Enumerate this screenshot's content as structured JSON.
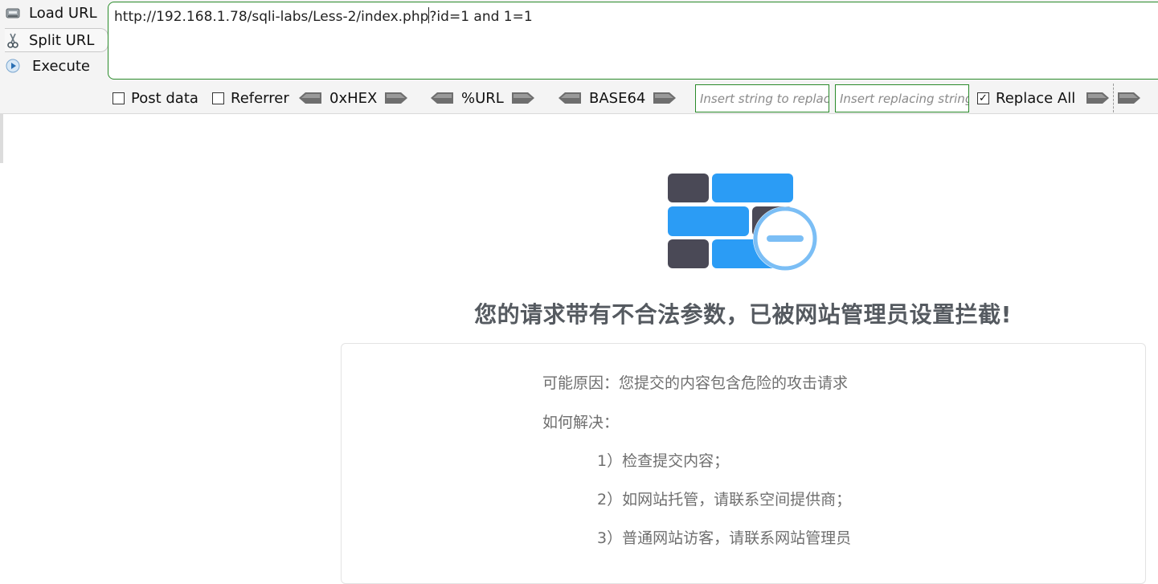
{
  "toolbar": {
    "load_url_label": "Load URL",
    "split_url_label": "Split URL",
    "execute_label": "Execute",
    "url_before_caret": "http://192.168.1.78/sqli-labs/Less-2/index.php",
    "url_after_caret": "?id=1 and 1=1",
    "post_data_label": "Post data",
    "referrer_label": "Referrer",
    "hex_label": "0xHEX",
    "url_enc_label": "%URL",
    "base64_label": "BASE64",
    "find_placeholder": "Insert string to replace",
    "replace_placeholder": "Insert replacing string",
    "replace_all_label": "Replace All",
    "post_data_checked": false,
    "referrer_checked": false,
    "replace_all_checked": true
  },
  "block_page": {
    "headline": "您的请求带有不合法参数，已被网站管理员设置拦截!",
    "reason": "可能原因：您提交的内容包含危险的攻击请求",
    "how_to_solve": "如何解决：",
    "steps": [
      "1）检查提交内容；",
      "2）如网站托管，请联系空间提供商；",
      "3）普通网站访客，请联系网站管理员"
    ]
  },
  "colors": {
    "brick_dark": "#4a4956",
    "brick_blue": "#2b9cf5",
    "ban_circle": "#7bbef5",
    "headline": "#555a60",
    "url_border": "#2a8a2a"
  }
}
